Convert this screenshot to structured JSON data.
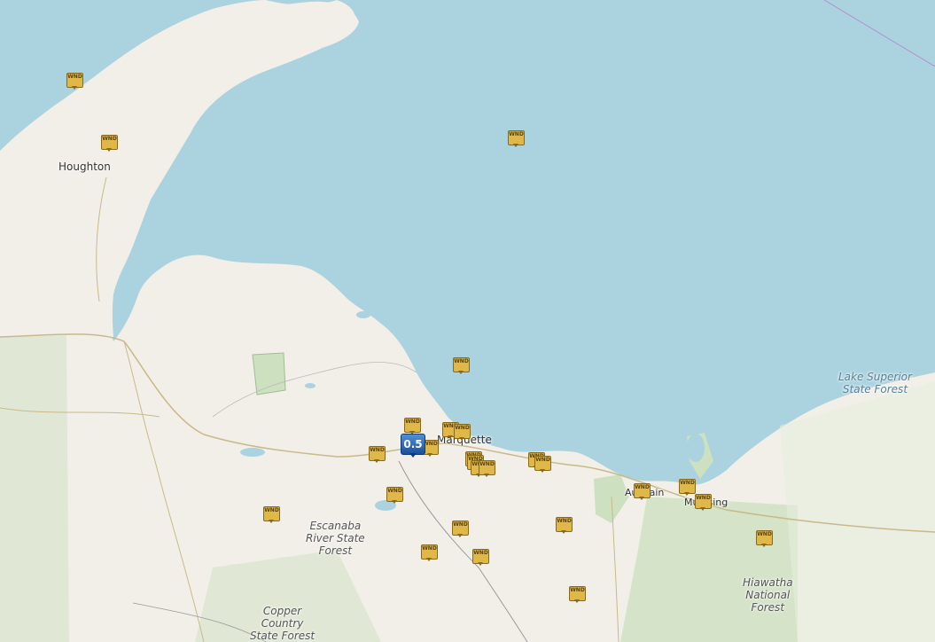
{
  "places": {
    "houghton": "Houghton",
    "marquette": "Marquette",
    "au_train": "Au Train",
    "munising": "Munising"
  },
  "forests": {
    "escanaba": "Escanaba\nRiver State\nForest",
    "copper_country": "Copper\nCountry\nState Forest",
    "hiawatha": "Hiawatha\nNational\nForest",
    "lake_superior": "Lake Superior\nState Forest"
  },
  "cluster": {
    "label": "0.5"
  },
  "marker_label": "WND",
  "colors": {
    "water": "#aad3df",
    "land": "#f2efe9",
    "forest": "#cde0bf",
    "marker": "#e0b84a",
    "cluster": "#2a62b3"
  }
}
